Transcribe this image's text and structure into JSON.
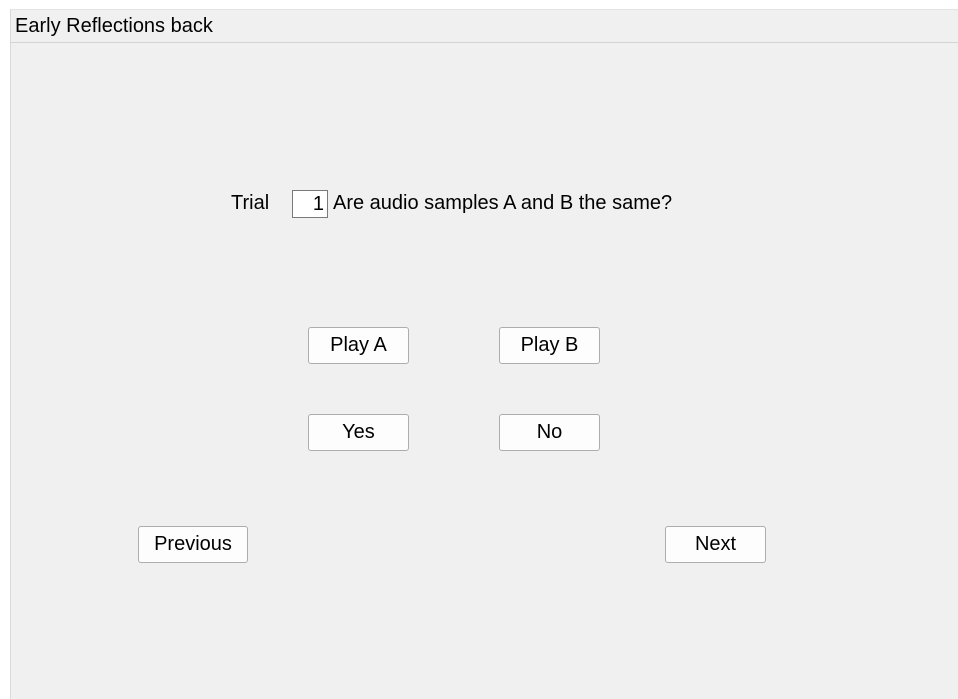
{
  "window": {
    "title": "Early Reflections back"
  },
  "trial": {
    "label": "Trial",
    "number": "1",
    "question": "Are audio samples A and B the same?"
  },
  "playback": {
    "play_a_label": "Play A",
    "play_b_label": "Play B"
  },
  "answer": {
    "yes_label": "Yes",
    "no_label": "No"
  },
  "navigation": {
    "previous_label": "Previous",
    "next_label": "Next"
  }
}
